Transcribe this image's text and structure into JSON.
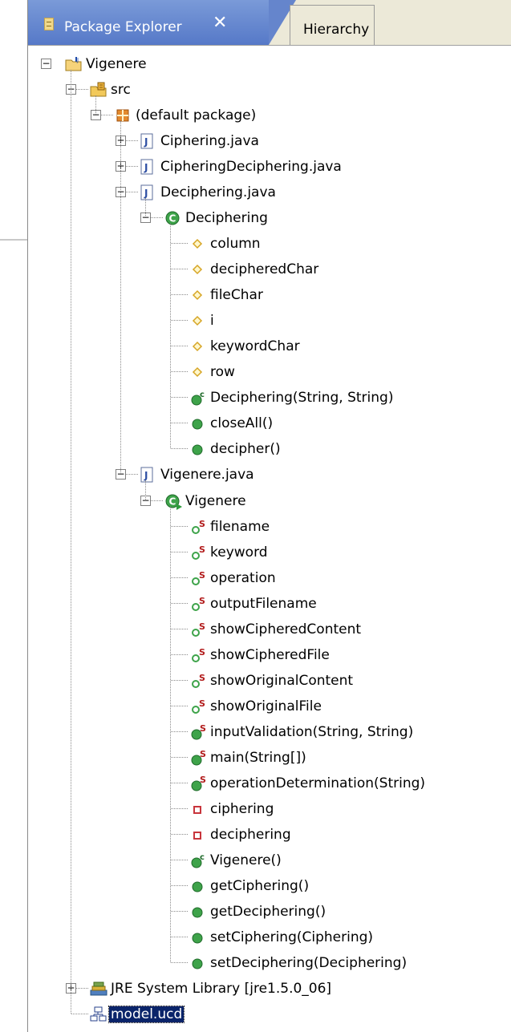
{
  "tabs": [
    {
      "label": "Package Explorer",
      "close": "✕",
      "active": true
    },
    {
      "label": "Hierarchy",
      "active": false
    }
  ],
  "tree": [
    {
      "label": "Vigenere",
      "icon": "project-icon",
      "toggle": "minus"
    },
    {
      "label": "src",
      "icon": "source-folder-icon",
      "toggle": "minus"
    },
    {
      "label": "(default package)",
      "icon": "package-icon",
      "toggle": "minus"
    },
    {
      "label": "Ciphering.java",
      "icon": "java-file-icon",
      "toggle": "plus"
    },
    {
      "label": "CipheringDeciphering.java",
      "icon": "java-file-icon",
      "toggle": "plus"
    },
    {
      "label": "Deciphering.java",
      "icon": "java-file-icon",
      "toggle": "minus"
    },
    {
      "label": "Deciphering",
      "icon": "class-icon",
      "toggle": "minus"
    },
    {
      "label": "column",
      "icon": "field-default-icon"
    },
    {
      "label": "decipheredChar",
      "icon": "field-default-icon"
    },
    {
      "label": "fileChar",
      "icon": "field-default-icon"
    },
    {
      "label": "i",
      "icon": "field-default-icon"
    },
    {
      "label": "keywordChar",
      "icon": "field-default-icon"
    },
    {
      "label": "row",
      "icon": "field-default-icon"
    },
    {
      "label": "Deciphering(String, String)",
      "icon": "constructor-icon"
    },
    {
      "label": "closeAll()",
      "icon": "public-method-icon"
    },
    {
      "label": "decipher()",
      "icon": "public-method-icon"
    },
    {
      "label": "Vigenere.java",
      "icon": "java-file-icon",
      "toggle": "minus"
    },
    {
      "label": "Vigenere",
      "icon": "main-class-icon",
      "toggle": "minus"
    },
    {
      "label": "filename",
      "icon": "static-field-icon"
    },
    {
      "label": "keyword",
      "icon": "static-field-icon"
    },
    {
      "label": "operation",
      "icon": "static-field-icon"
    },
    {
      "label": "outputFilename",
      "icon": "static-field-icon"
    },
    {
      "label": "showCipheredContent",
      "icon": "static-field-icon"
    },
    {
      "label": "showCipheredFile",
      "icon": "static-field-icon"
    },
    {
      "label": "showOriginalContent",
      "icon": "static-field-icon"
    },
    {
      "label": "showOriginalFile",
      "icon": "static-field-icon"
    },
    {
      "label": "inputValidation(String, String)",
      "icon": "static-method-icon"
    },
    {
      "label": "main(String[])",
      "icon": "static-method-icon"
    },
    {
      "label": "operationDetermination(String)",
      "icon": "static-method-icon"
    },
    {
      "label": "ciphering",
      "icon": "private-field-icon"
    },
    {
      "label": "deciphering",
      "icon": "private-field-icon"
    },
    {
      "label": "Vigenere()",
      "icon": "constructor-icon"
    },
    {
      "label": "getCiphering()",
      "icon": "public-method-icon"
    },
    {
      "label": "getDeciphering()",
      "icon": "public-method-icon"
    },
    {
      "label": "setCiphering(Ciphering)",
      "icon": "public-method-icon"
    },
    {
      "label": "setDeciphering(Deciphering)",
      "icon": "public-method-icon"
    },
    {
      "label": "JRE System Library [jre1.5.0_06]",
      "icon": "library-icon",
      "toggle": "plus"
    },
    {
      "label": "model.ucd",
      "icon": "ucd-diagram-icon",
      "selected": true
    }
  ],
  "icon_letters": {
    "class": "C",
    "constructor": "c",
    "static": "S",
    "main_run": "▶"
  },
  "colors": {
    "tab_active": "#6585cc",
    "selection": "#0a246a",
    "method_green": "#3ea34a",
    "field_yellow": "#d6a525",
    "private_red": "#c8353c",
    "static_red": "#b21b1b"
  }
}
